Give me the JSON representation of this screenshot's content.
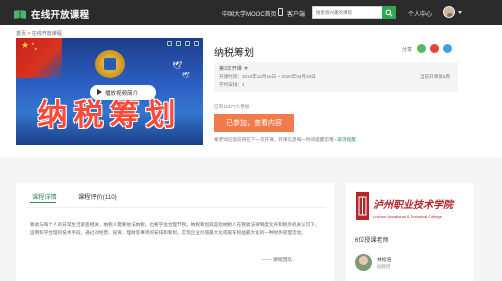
{
  "header": {
    "logo_text": "在线开放课程",
    "nav": [
      "中国大学MOOC首页",
      "客户端"
    ],
    "search_placeholder": "搜索感兴趣的课程",
    "user_center": "个人中心"
  },
  "breadcrumb": "首页 > 在线开放课程",
  "course": {
    "title": "纳税筹划",
    "cover_text": "纳税筹划",
    "play_label": "播放视频简介",
    "share_label": "分享",
    "term": {
      "select_label": "第3次开课",
      "date_line": "开课时间：2019年12月16日 ~ 2020年03月28日",
      "hours_line": "学时安排：4",
      "status": "当前开课第8周"
    },
    "enrolled": "已有11677人参加",
    "join_button": "已参加，查看内容",
    "notice": "秦老师已提前将在下一次开课，开课信息每一时间提醒您哦~",
    "notice_link": "取消提醒"
  },
  "details": {
    "tabs": [
      "课程详情",
      "课程评价(110)"
    ],
    "description": "税收与每个人的日常生活紧密相关，纳税人需要依法纳税，也要学会合理节税。纳税筹划就是指纳税人在税收法律制度允许和税务机关认可下，运用科学合理的技术手段，通过对经营、投资、理财等事项的安排和筹划，实现企业价值最大化或股东权益最大化的一种财务管理活动。",
    "signature": "—— 课程团队"
  },
  "sidebar": {
    "school_name_cn": "泸州职业技术学院",
    "school_name_en": "Luzhou Vocational & Technical College",
    "teachers_title": "6位授课老师",
    "teacher": {
      "name": "林松浩",
      "title": "副教授"
    }
  },
  "colors": {
    "topbar": "#2b2b2b",
    "brand_green": "#2e8b57",
    "join_orange": "#f27b4c",
    "search_green": "#31a653"
  }
}
